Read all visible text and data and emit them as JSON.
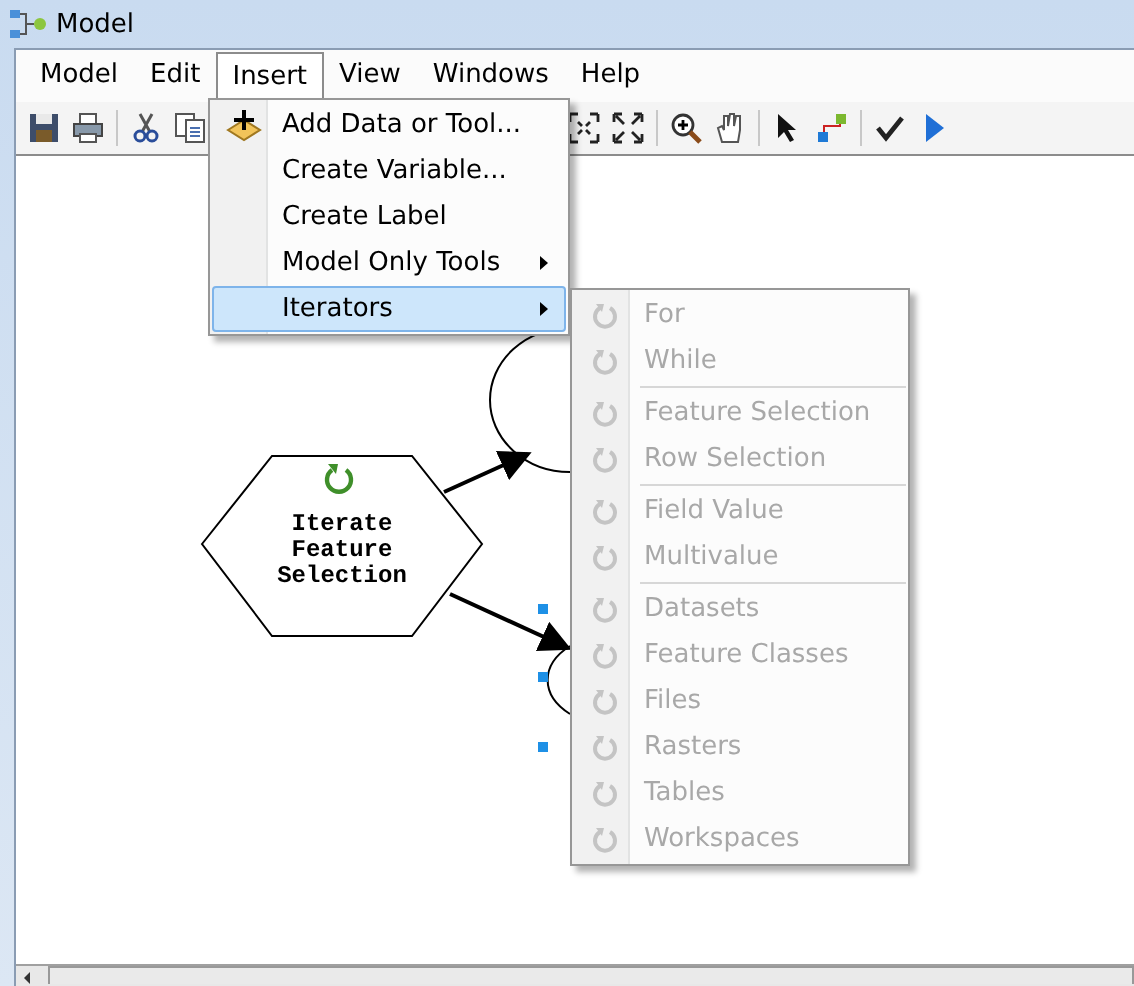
{
  "window": {
    "title": "Model"
  },
  "menu_bar": [
    {
      "label": "Model",
      "selected": false
    },
    {
      "label": "Edit",
      "selected": false
    },
    {
      "label": "Insert",
      "selected": true
    },
    {
      "label": "View",
      "selected": false
    },
    {
      "label": "Windows",
      "selected": false
    },
    {
      "label": "Help",
      "selected": false
    }
  ],
  "insert_menu": {
    "items": [
      {
        "label": "Add Data or Tool...",
        "kind": "command",
        "selected": false
      },
      {
        "label": "Create Variable...",
        "kind": "command",
        "selected": false
      },
      {
        "label": "Create Label",
        "kind": "command",
        "selected": false
      },
      {
        "label": "Model Only Tools",
        "kind": "submenu",
        "selected": false
      },
      {
        "label": "Iterators",
        "kind": "submenu",
        "selected": true
      }
    ]
  },
  "iterators_menu": {
    "groups": [
      {
        "items": [
          {
            "label": "For",
            "disabled": true
          },
          {
            "label": "While",
            "disabled": true
          }
        ]
      },
      {
        "items": [
          {
            "label": "Feature Selection",
            "disabled": true
          },
          {
            "label": "Row Selection",
            "disabled": true
          }
        ]
      },
      {
        "items": [
          {
            "label": "Field Value",
            "disabled": true
          },
          {
            "label": "Multivalue",
            "disabled": true
          }
        ]
      },
      {
        "items": [
          {
            "label": "Datasets",
            "disabled": true
          },
          {
            "label": "Feature Classes",
            "disabled": true
          },
          {
            "label": "Files",
            "disabled": true
          },
          {
            "label": "Rasters",
            "disabled": true
          },
          {
            "label": "Tables",
            "disabled": true
          },
          {
            "label": "Workspaces",
            "disabled": true
          }
        ]
      }
    ]
  },
  "diagram": {
    "iterator_node": {
      "lines": [
        "Iterate",
        "Feature",
        "Selection"
      ]
    }
  }
}
